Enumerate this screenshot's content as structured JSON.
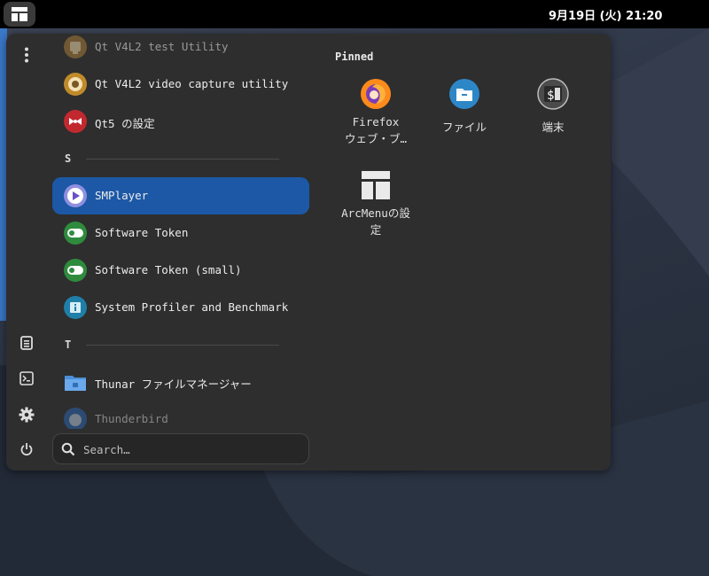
{
  "topbar": {
    "clock": "9月19日 (火) 21:20",
    "menu_icon": "layout-icon"
  },
  "sidebar": {
    "buttons": [
      {
        "name": "more-icon"
      },
      {
        "name": "document-icon"
      },
      {
        "name": "terminal-icon"
      },
      {
        "name": "settings-icon"
      },
      {
        "name": "power-icon"
      }
    ]
  },
  "apps": {
    "rows": [
      {
        "label": "Qt V4L2 test Utility",
        "icon": "qt-v4l2-test-icon"
      },
      {
        "label": "Qt V4L2 video capture utility",
        "icon": "qt-v4l2-capture-icon"
      },
      {
        "label": "Qt5 の設定",
        "icon": "qt5-settings-icon"
      },
      {
        "label": "SMPlayer",
        "icon": "smplayer-icon"
      },
      {
        "label": "Software Token",
        "icon": "software-token-icon"
      },
      {
        "label": "Software Token (small)",
        "icon": "software-token-small-icon"
      },
      {
        "label": "System Profiler and Benchmark",
        "icon": "system-profiler-icon"
      },
      {
        "label": "Thunar ファイルマネージャー",
        "icon": "thunar-folder-icon"
      },
      {
        "label": "Thunderbird",
        "icon": "thunderbird-icon"
      }
    ],
    "sections": [
      "S",
      "T"
    ]
  },
  "search": {
    "placeholder": "Search…"
  },
  "pinned": {
    "title": "Pinned",
    "items": [
      {
        "label": "Firefox\nウェブ・ブ…",
        "line1": "Firefox",
        "line2": "ウェブ・ブ…",
        "icon": "firefox-icon"
      },
      {
        "label": "ファイル",
        "icon": "files-icon"
      },
      {
        "label": "端末",
        "icon": "terminal-app-icon"
      },
      {
        "label": "ArcMenuの設定",
        "line1": "ArcMenuの設",
        "line2": "定",
        "icon": "arcmenu-settings-icon"
      }
    ]
  },
  "colors": {
    "selected": "#1c58a6",
    "panel": "#2e2e2e",
    "topbar": "#000000"
  }
}
